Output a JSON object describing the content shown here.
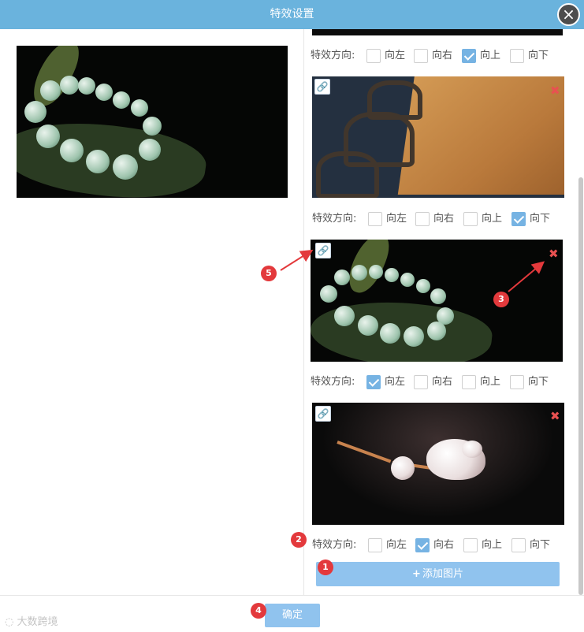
{
  "dialog": {
    "title": "特效设置",
    "close_icon": "×"
  },
  "direction_label": "特效方向:",
  "directions": [
    "向左",
    "向右",
    "向上",
    "向下"
  ],
  "image_list": [
    {
      "name": "jade-bracelet",
      "selected_direction": "向上"
    },
    {
      "name": "wooden-table",
      "selected_direction": "向下"
    },
    {
      "name": "jade-bracelet",
      "selected_direction": "向左"
    },
    {
      "name": "pearl-bracelet",
      "selected_direction": "向右"
    }
  ],
  "icons": {
    "link": "link-icon",
    "delete": "close-icon",
    "delete_glyph": "✖",
    "link_glyph": "🔗"
  },
  "add_button": {
    "label": "添加图片",
    "icon": "+"
  },
  "confirm_button": {
    "label": "确定"
  },
  "annotations": [
    "1",
    "2",
    "3",
    "4",
    "5"
  ],
  "watermark": {
    "text": "大数跨境"
  },
  "colors": {
    "titlebar": "#6ab3dd",
    "button": "#90c3ee",
    "badge": "#e3393c",
    "delete": "#e85151"
  }
}
